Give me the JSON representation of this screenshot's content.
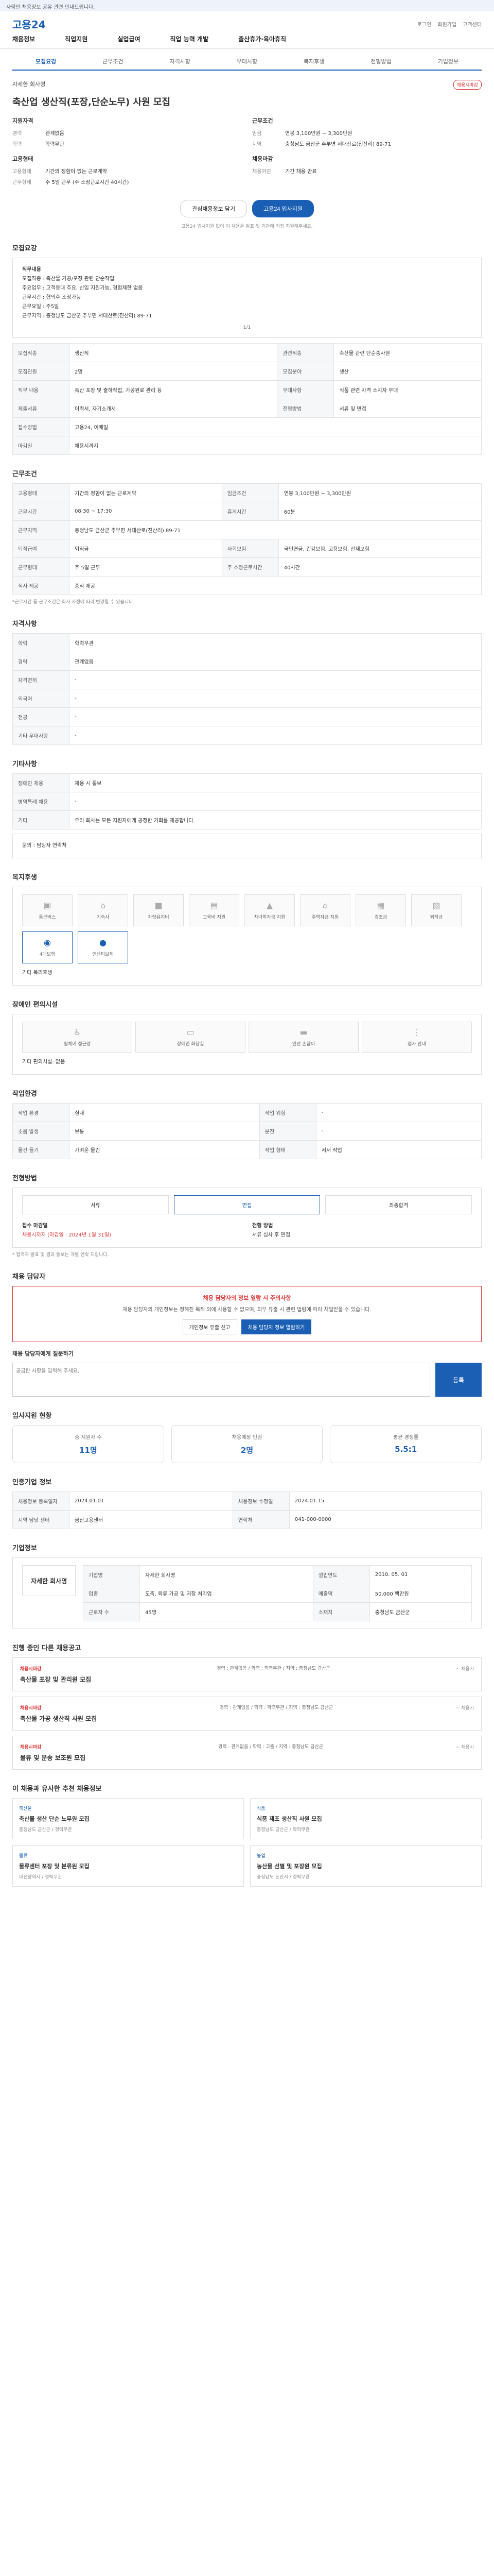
{
  "topnotice": "사람인 채용정보 공유 관련 안내드립니다.",
  "header": {
    "logo": "고용24",
    "right1": "로그인",
    "right2": "회원가입",
    "right3": "고객센터"
  },
  "gnb": [
    "채용정보",
    "직업지원",
    "실업급여",
    "직업 능력 개발",
    "출산휴가·육아휴직"
  ],
  "tabs": [
    "모집요강",
    "근무조건",
    "자격사항",
    "우대사항",
    "복지후생",
    "전형방법",
    "기업정보"
  ],
  "company": "자세한 회사명",
  "badge": "채용시마감",
  "title": "축산업 생산직(포장,단순노무) 사원 모집",
  "summary": {
    "left_title": "지원자격",
    "left": [
      [
        "경력",
        "관계없음"
      ],
      [
        "학력",
        "학력무관"
      ]
    ],
    "left2_title": "고용형태",
    "left2": [
      [
        "고용형태",
        "기간의 정함이 없는 근로계약"
      ],
      [
        "근무형태",
        "주 5일 근무 (주 소정근로시간 40시간)"
      ]
    ],
    "right_title": "근무조건",
    "right": [
      [
        "임금",
        "연봉 3,100만원 ~ 3,300만원"
      ],
      [
        "지역",
        "충청남도 금산군 추부면 서대산로(진산리) 89-71"
      ]
    ],
    "right2_title": "채용마감",
    "right2": [
      [
        "채용마감",
        "기간 채용 만료"
      ]
    ]
  },
  "buttons": {
    "like": "관심채용정보 담기",
    "apply": "고용24 입사지원"
  },
  "note": "고용24 입사지원 없이 이 채용은 발표 및 기관에 직접 지원해주세요.",
  "recruit": {
    "h": "모집요강",
    "body": [
      "직무내용",
      "모집직종 : 축산물 가공/포장 관련 단순작업",
      "주요업무 : 고객응대 주요, 신입 지원가능, 경험제한 없음",
      "근무시간 : 협의후 조정가능",
      "근무요일 : 주5일",
      "근무지역 : 충청남도 금산군 추부면 서대산로(진산리) 89-71"
    ],
    "pager": "1/1",
    "rows": [
      [
        "모집직종",
        "생산직",
        "관련직종",
        "축산물 관련 단순종사원"
      ],
      [
        "모집인원",
        "2명",
        "모집분야",
        "생산"
      ],
      [
        "직무 내용",
        "축산 포장 및 출하작업, 가공원료 관리 등",
        "우대사항",
        "식품 관련 자격 소지자 우대"
      ],
      [
        "제출서류",
        "이력서, 자기소개서",
        "전형방법",
        "서류 및 면접"
      ],
      [
        "접수방법",
        "고용24, 이메일",
        "",
        ""
      ],
      [
        "마감일",
        "채용시까지",
        "",
        ""
      ]
    ]
  },
  "work": {
    "h": "근무조건",
    "rows": [
      [
        "고용형태",
        "기간의 정함이 없는 근로계약",
        "임금조건",
        "연봉 3,100만원 ~ 3,300만원"
      ],
      [
        "근무시간",
        "08:30 ~ 17:30",
        "휴게시간",
        "60분"
      ],
      [
        "근무지역",
        "충청남도 금산군 추부면 서대산로(진산리) 89-71",
        "",
        ""
      ],
      [
        "퇴직급여",
        "퇴직금",
        "사회보험",
        "국민연금, 건강보험, 고용보험, 산재보험"
      ],
      [
        "근무형태",
        "주 5일 근무",
        "주 소정근로시간",
        "40시간"
      ],
      [
        "식사 제공",
        "중식 제공",
        "",
        ""
      ]
    ],
    "small": "*근로시간 등 근무조건은 회사 사정에 따라 변경될 수 있습니다."
  },
  "qual": {
    "h": "자격사항",
    "rows": [
      [
        "학력",
        "학력무관"
      ],
      [
        "경력",
        "관계없음"
      ],
      [
        "자격면허",
        "-"
      ],
      [
        "외국어",
        "-"
      ],
      [
        "전공",
        "-"
      ],
      [
        "기타 우대사항",
        "-"
      ]
    ]
  },
  "etc": {
    "h": "기타사항",
    "rows": [
      [
        "장애인 채용",
        "채용 시 통보"
      ],
      [
        "병역특례 채용",
        "-"
      ],
      [
        "기타",
        "우리 회사는 모든 지원자에게 공정한 기회를 제공합니다."
      ]
    ],
    "contact": "문의 : 담당자 연락처"
  },
  "welfare": {
    "h": "복지후생",
    "icons": [
      "통근버스",
      "기숙사",
      "차량유지비",
      "교육비 지원",
      "자녀학자금 지원",
      "주택자금 지원",
      "경조금",
      "퇴직금",
      "4대보험",
      "인센티브제"
    ],
    "active": [
      8,
      9
    ],
    "etc_label": "기타 복리후생"
  },
  "disabled": {
    "h": "장애인 편의시설",
    "icons": [
      "휠체어 접근성",
      "장애인 화장실",
      "안전 손잡이",
      "점자 안내"
    ],
    "etc": "기타 편의시설: 없음"
  },
  "environment": {
    "h": "작업환경",
    "rows": [
      [
        "작업 환경",
        "실내",
        "작업 위험",
        "-"
      ],
      [
        "소음 발생",
        "보통",
        "분진",
        "-"
      ],
      [
        "물건 들기",
        "가벼운 물건",
        "작업 형태",
        "서서 작업"
      ]
    ]
  },
  "process": {
    "h": "전형방법",
    "steps": [
      "서류",
      "면접",
      "최종합격"
    ],
    "labels": [
      "접수 마감일",
      "전형 방법"
    ],
    "values": [
      "채용시까지 (마감일 : 2024년 1월 31일)",
      "서류 심사 후 면접"
    ],
    "small": "* 합격자 발표 및 결과 통보는 개별 연락 드립니다."
  },
  "contact": {
    "h": "채용 담당자",
    "alert": "채용 담당자의 정보 열람 시 주의사항",
    "desc": "채용 담당자의 개인정보는 정해진 목적 외에 사용할 수 없으며, 외부 유출 시 관련 법령에 따라 처벌받을 수 있습니다.",
    "b1": "개인정보 유출 신고",
    "b2": "채용 담당자 정보 열람하기",
    "qlabel": "채용 담당자에게 질문하기",
    "q_placeholder": "궁금한 사항을 입력해 주세요.",
    "q_btn": "등록"
  },
  "stats": {
    "h": "입사지원 현황",
    "items": [
      [
        "총 지원자 수",
        "11명"
      ],
      [
        "채용예정 인원",
        "2명"
      ],
      [
        "평균 경쟁률",
        "5.5:1"
      ]
    ]
  },
  "info": {
    "h": "인증기업 정보",
    "rows": [
      [
        "채용정보 등록일자",
        "2024.01.01",
        "채용정보 수정일",
        "2024.01.15"
      ],
      [
        "지역 담당 센터",
        "금산고용센터",
        "연락처",
        "041-000-0000"
      ]
    ]
  },
  "corp": {
    "h": "기업정보",
    "logo": "자세한 회사명",
    "rows": [
      [
        "기업명",
        "자세한 회사명",
        "설립연도",
        "2010. 05. 01"
      ],
      [
        "업종",
        "도축, 육류 가공 및 저장 처리업",
        "매출액",
        "50,000 백만원"
      ],
      [
        "근로자 수",
        "45명",
        "소재지",
        "충청남도 금산군"
      ]
    ]
  },
  "similar": {
    "h": "진행 중인 다른 채용공고",
    "items": [
      {
        "c": "채용시마감",
        "n": "축산물 포장 및 관리원 모집",
        "m": "경력 : 관계없음 / 학력 : 학력무관 / 지역 : 충청남도 금산군",
        "r": "~ 채용시"
      },
      {
        "c": "채용시마감",
        "n": "축산물 가공 생산직 사원 모집",
        "m": "경력 : 관계없음 / 학력 : 학력무관 / 지역 : 충청남도 금산군",
        "r": "~ 채용시"
      },
      {
        "c": "채용시마감",
        "n": "물류 및 운송 보조원 모집",
        "m": "경력 : 관계없음 / 학력 : 고졸 / 지역 : 충청남도 금산군",
        "r": "~ 채용시"
      }
    ]
  },
  "recommend": {
    "h": "이 채용과 유사한 추천 채용정보",
    "items": [
      {
        "c": "축산물",
        "n": "축산물 생산 단순 노무원 모집",
        "m": "충청남도 금산군 / 경력무관"
      },
      {
        "c": "식품",
        "n": "식품 제조 생산직 사원 모집",
        "m": "충청남도 금산군 / 학력무관"
      },
      {
        "c": "물류",
        "n": "물류센터 포장 및 분류원 모집",
        "m": "대전광역시 / 경력무관"
      },
      {
        "c": "농업",
        "n": "농산물 선별 및 포장원 모집",
        "m": "충청남도 논산시 / 경력무관"
      }
    ]
  }
}
